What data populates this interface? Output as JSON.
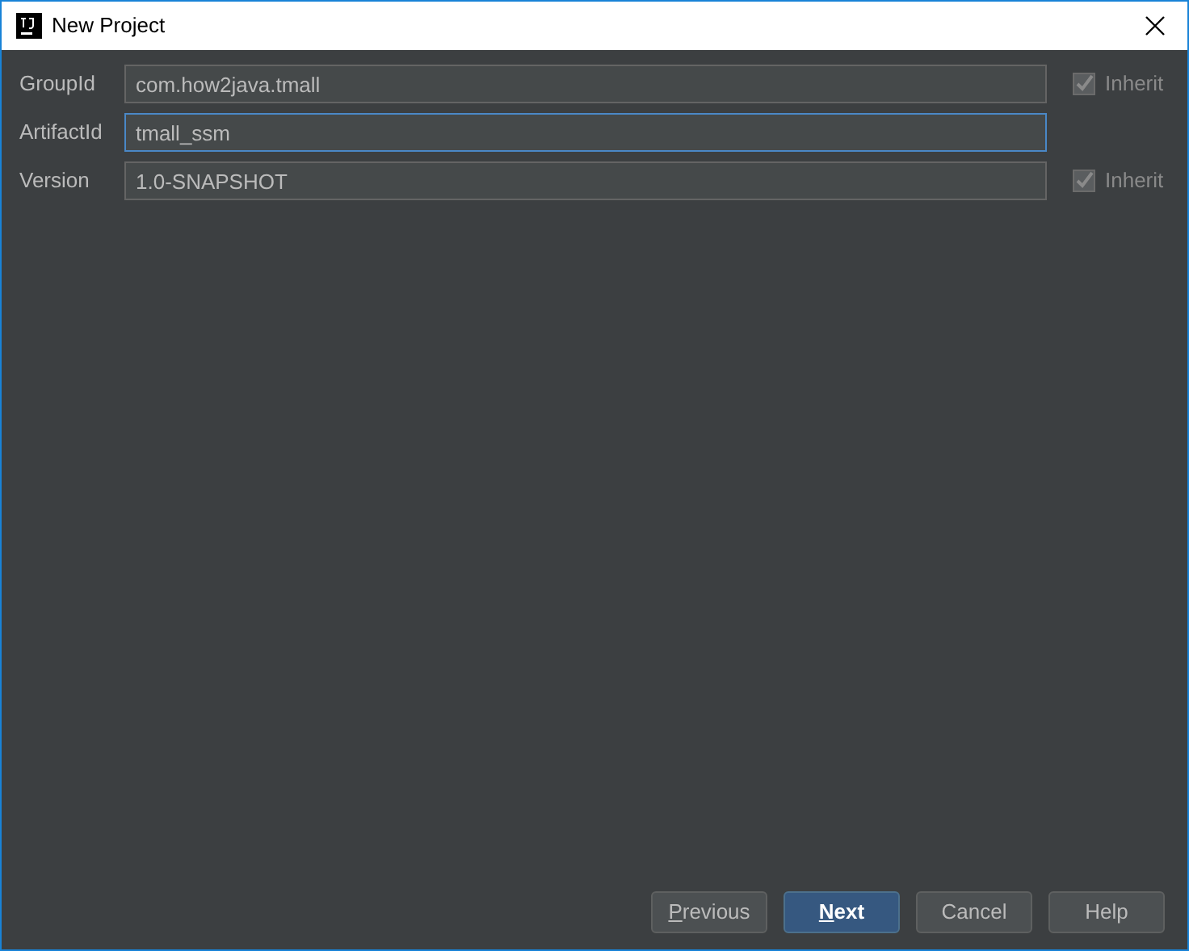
{
  "window": {
    "title": "New Project"
  },
  "fields": [
    {
      "label": "GroupId",
      "value": "com.how2java.tmall",
      "focused": false,
      "inherit": {
        "label": "Inherit",
        "checked": true
      }
    },
    {
      "label": "ArtifactId",
      "value": "tmall_ssm",
      "focused": true
    },
    {
      "label": "Version",
      "value": "1.0-SNAPSHOT",
      "focused": false,
      "inherit": {
        "label": "Inherit",
        "checked": true
      }
    }
  ],
  "buttons": [
    {
      "label": "Previous",
      "default": false,
      "mnemonic": true
    },
    {
      "label": "Next",
      "default": true,
      "mnemonic": true
    },
    {
      "label": "Cancel",
      "default": false,
      "mnemonic": false
    },
    {
      "label": "Help",
      "default": false,
      "mnemonic": false
    }
  ]
}
